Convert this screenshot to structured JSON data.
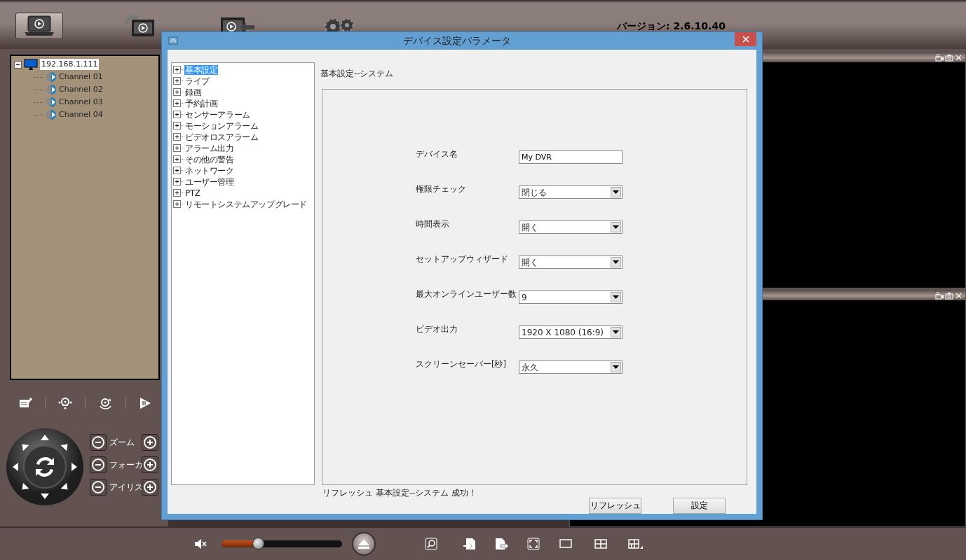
{
  "toolbar": {
    "buttons": [
      {
        "kind": "live",
        "selected": true
      },
      {
        "kind": "playback",
        "selected": false
      },
      {
        "kind": "backup",
        "selected": false
      },
      {
        "kind": "settings",
        "selected": false
      }
    ],
    "version": "バージョン: 2.6.10.40"
  },
  "device_tree": {
    "host": "192.168.1.111",
    "expanded": true,
    "channels": [
      "Channel 01",
      "Channel 02",
      "Channel 03",
      "Channel 04"
    ]
  },
  "ptz": {
    "controls": [
      {
        "label": "ズーム"
      },
      {
        "label": "フォーカ"
      },
      {
        "label": "アイリス"
      }
    ]
  },
  "volume": {
    "muted": true,
    "level": 0.3
  },
  "dialog": {
    "title": "デバイス設定パラメータ",
    "menu": [
      {
        "label": "基本設定",
        "selected": true
      },
      {
        "label": "ライブ",
        "selected": false
      },
      {
        "label": "録画",
        "selected": false
      },
      {
        "label": "予約計画",
        "selected": false
      },
      {
        "label": "センサーアラーム",
        "selected": false
      },
      {
        "label": "モーションアラーム",
        "selected": false
      },
      {
        "label": "ビデオロスアラーム",
        "selected": false
      },
      {
        "label": "アラーム出力",
        "selected": false
      },
      {
        "label": "その他の警告",
        "selected": false
      },
      {
        "label": "ネットワーク",
        "selected": false
      },
      {
        "label": "ユーザー管理",
        "selected": false
      },
      {
        "label": "PTZ",
        "selected": false
      },
      {
        "label": "リモートシステムアップグレード",
        "selected": false
      }
    ],
    "section_title": "基本設定--システム",
    "fields": [
      {
        "kind": "text",
        "label": "デバイス名",
        "value": "My DVR"
      },
      {
        "kind": "select",
        "label": "権限チェック",
        "value": "閉じる"
      },
      {
        "kind": "select",
        "label": "時間表示",
        "value": "開く"
      },
      {
        "kind": "select",
        "label": "セットアップウィザード",
        "value": "開く"
      },
      {
        "kind": "select",
        "label": "最大オンラインユーザー数",
        "value": "9"
      },
      {
        "kind": "select",
        "label": "ビデオ出力",
        "value": "1920 X 1080 (16:9)"
      },
      {
        "kind": "select",
        "label": "スクリーンセーバー[秒]",
        "value": "永久"
      }
    ],
    "status": "リフレッシュ 基本設定--システム 成功！",
    "buttons": [
      "リフレッシュ",
      "設定"
    ]
  }
}
